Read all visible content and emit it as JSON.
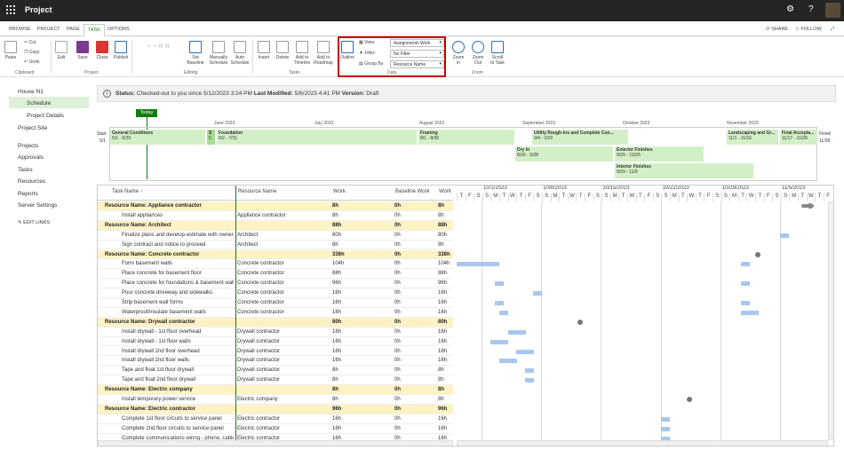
{
  "app": {
    "title": "Project"
  },
  "tabs": [
    {
      "label": "BROWSE"
    },
    {
      "label": "PROJECT"
    },
    {
      "label": "PAGE"
    },
    {
      "label": "TASK"
    },
    {
      "label": "OPTIONS"
    }
  ],
  "tabs_right": {
    "share": "SHARE",
    "follow": "FOLLOW"
  },
  "ribbon": {
    "clipboard": {
      "paste": "Paste",
      "cut": "Cut",
      "copy": "Copy",
      "undo": "Undo",
      "group": "Clipboard"
    },
    "project": {
      "edit": "Edit",
      "save": "Save",
      "close": "Close",
      "publish": "Publish",
      "group": "Project"
    },
    "editing": {
      "set_baseline": "Set Baseline",
      "manually": "Manually Schedule",
      "auto": "Auto Schedule",
      "group": "Editing"
    },
    "tasks": {
      "insert": "Insert",
      "delete": "Delete",
      "add_timeline": "Add to Timeline",
      "add_roadmap": "Add to Roadmap",
      "group": "Tasks"
    },
    "data": {
      "outline": "Outline",
      "view": "View:",
      "filter": "Filter:",
      "groupby": "Group By:",
      "view_value": "Assignments Work",
      "filter_value": "No Filter",
      "groupby_value": "Resource Name",
      "group": "Data"
    },
    "zoom": {
      "zoom_in": "Zoom In",
      "zoom_out": "Zoom Out",
      "scroll": "Scroll to Task",
      "group": "Zoom"
    }
  },
  "nav": {
    "items": [
      "House N1",
      "Schedule",
      "Project Details",
      "Project Site",
      "Projects",
      "Approvals",
      "Tasks",
      "Resources",
      "Reports",
      "Server Settings"
    ],
    "edit_links": "EDIT LINKS"
  },
  "status": {
    "label": "Status:",
    "checked": "Checked-out to you since 5/12/2023 3:24 PM",
    "lm_label": "Last Modified:",
    "lm_value": "5/6/2023 4:41 PM",
    "ver_label": "Version:",
    "ver_value": "Draft"
  },
  "timeline": {
    "today": "Today",
    "start_label": "Start",
    "start_date": "5/1",
    "finish_label": "Finish",
    "finish_date": "11/28",
    "months": [
      "June 2023",
      "July 2023",
      "August 2023",
      "September 2023",
      "October 2023",
      "November 2023"
    ],
    "bars": [
      {
        "name": "General Conditions",
        "dates": "5/1 - 5/29"
      },
      {
        "name": "S",
        "dates": "5"
      },
      {
        "name": "Foundation",
        "dates": "6/2 - 7/31"
      },
      {
        "name": "Framing",
        "dates": "8/1 - 8/30"
      },
      {
        "name": "Utility Rough-Ins and Complete Con...",
        "dates": "9/4 - 10/2"
      },
      {
        "name": "Landscaping and Gr...",
        "dates": "11/1 - 11/16"
      },
      {
        "name": "Final Accepta...",
        "dates": "11/17 - 11/28"
      },
      {
        "name": "Dry In",
        "dates": "8/30 - 9/28"
      },
      {
        "name": "Exterior Finishes",
        "dates": "9/29 - 10/25"
      },
      {
        "name": "Interior Finishes",
        "dates": "9/29 - 11/9"
      }
    ]
  },
  "grid": {
    "headers": {
      "task": "Task Name ↑",
      "resource": "Resource Name",
      "work": "Work",
      "baseline": "Baseline Work",
      "work2": "Work"
    },
    "weeks": [
      "10/1/2023",
      "10/8/2023",
      "10/15/2023",
      "10/22/2023",
      "10/29/2023",
      "11/5/2023"
    ],
    "days": [
      "T",
      "F",
      "S",
      "S",
      "M",
      "T",
      "W",
      "T",
      "F",
      "S",
      "S",
      "M",
      "T",
      "W",
      "T",
      "F",
      "S",
      "S",
      "M",
      "T",
      "W",
      "T",
      "F",
      "S",
      "S",
      "M",
      "T",
      "W",
      "T",
      "F",
      "S",
      "S",
      "M",
      "T",
      "W",
      "T",
      "F",
      "S",
      "S",
      "M",
      "T",
      "W",
      "T",
      "F"
    ],
    "rows": [
      {
        "g": true,
        "task": "Resource Name: Appliance contractor",
        "res": "",
        "work": "8h",
        "base": "0h",
        "work2": "8h"
      },
      {
        "g": false,
        "task": "Install appliances",
        "res": "Appliance contractor",
        "work": "8h",
        "base": "0h",
        "work2": "8h"
      },
      {
        "g": true,
        "task": "Resource Name: Architect",
        "res": "",
        "work": "88h",
        "base": "0h",
        "work2": "88h"
      },
      {
        "g": false,
        "task": "Finalize plans and develop estimate with owner",
        "res": "Architect",
        "work": "80h",
        "base": "0h",
        "work2": "80h"
      },
      {
        "g": false,
        "task": "Sign contract and notice to proceed",
        "res": "Architect",
        "work": "8h",
        "base": "0h",
        "work2": "8h"
      },
      {
        "g": true,
        "task": "Resource Name: Concrete contractor",
        "res": "",
        "work": "336h",
        "base": "0h",
        "work2": "336h"
      },
      {
        "g": false,
        "task": "Form basement walls",
        "res": "Concrete contractor",
        "work": "104h",
        "base": "0h",
        "work2": "104h"
      },
      {
        "g": false,
        "task": "Place concrete for basement floor",
        "res": "Concrete contractor",
        "work": "88h",
        "base": "0h",
        "work2": "88h"
      },
      {
        "g": false,
        "task": "Place concrete for foundations & basement walls",
        "res": "Concrete contractor",
        "work": "96h",
        "base": "0h",
        "work2": "96h"
      },
      {
        "g": false,
        "task": "Pour concrete driveway and sidewalks",
        "res": "Concrete contractor",
        "work": "16h",
        "base": "0h",
        "work2": "16h"
      },
      {
        "g": false,
        "task": "Strip basement wall forms",
        "res": "Concrete contractor",
        "work": "16h",
        "base": "0h",
        "work2": "16h"
      },
      {
        "g": false,
        "task": "Waterproof/insulate basement walls",
        "res": "Concrete contractor",
        "work": "16h",
        "base": "0h",
        "work2": "16h"
      },
      {
        "g": true,
        "task": "Resource Name: Drywall contractor",
        "res": "",
        "work": "80h",
        "base": "0h",
        "work2": "80h"
      },
      {
        "g": false,
        "task": "Install drywall - 1st floor overhead",
        "res": "Drywall contractor",
        "work": "16h",
        "base": "0h",
        "work2": "16h"
      },
      {
        "g": false,
        "task": "Install drywall - 1st floor walls",
        "res": "Drywall contractor",
        "work": "16h",
        "base": "0h",
        "work2": "16h"
      },
      {
        "g": false,
        "task": "Install drywall 2nd floor overhead",
        "res": "Drywall contractor",
        "work": "16h",
        "base": "0h",
        "work2": "16h"
      },
      {
        "g": false,
        "task": "Install drywall 2nd floor walls",
        "res": "Drywall contractor",
        "work": "16h",
        "base": "0h",
        "work2": "16h"
      },
      {
        "g": false,
        "task": "Tape and float 1st floor drywall",
        "res": "Drywall contractor",
        "work": "8h",
        "base": "0h",
        "work2": "8h"
      },
      {
        "g": false,
        "task": "Tape and float 2nd floor drywall",
        "res": "Drywall contractor",
        "work": "8h",
        "base": "0h",
        "work2": "8h"
      },
      {
        "g": true,
        "task": "Resource Name: Electric company",
        "res": "",
        "work": "8h",
        "base": "0h",
        "work2": "8h"
      },
      {
        "g": false,
        "task": "Install temporary power service",
        "res": "Electric company",
        "work": "8h",
        "base": "0h",
        "work2": "8h"
      },
      {
        "g": true,
        "task": "Resource Name: Electric contractor",
        "res": "",
        "work": "96h",
        "base": "0h",
        "work2": "96h"
      },
      {
        "g": false,
        "task": "Complete 1st floor circuits to service panel",
        "res": "Electric contractor",
        "work": "16h",
        "base": "0h",
        "work2": "16h"
      },
      {
        "g": false,
        "task": "Complete 2nd floor circuits to service panel",
        "res": "Electric contractor",
        "work": "16h",
        "base": "0h",
        "work2": "16h"
      },
      {
        "g": false,
        "task": "Complete communications wiring - phone, cable",
        "res": "Electric contractor",
        "work": "16h",
        "base": "0h",
        "work2": "16h"
      }
    ]
  }
}
